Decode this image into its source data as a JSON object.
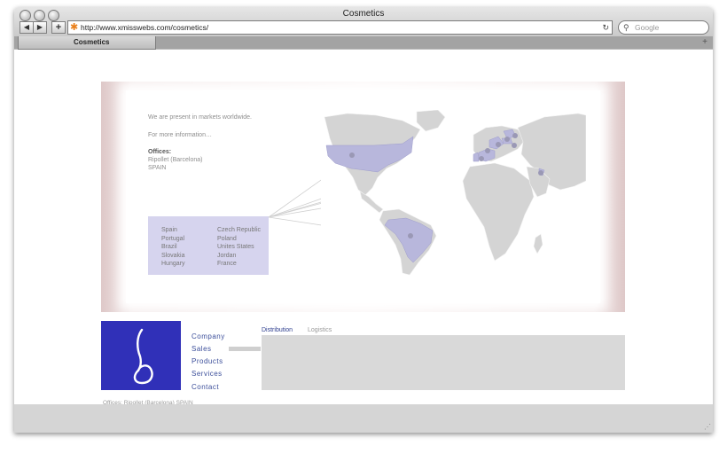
{
  "window": {
    "title": "Cosmetics",
    "url": "http://www.xmisswebs.com/cosmetics/",
    "search_placeholder": "Google",
    "tab_label": "Cosmetics",
    "back_glyph": "◀",
    "forward_glyph": "▶",
    "add_glyph": "+",
    "reload_glyph": "↻",
    "search_glyph": "⚲",
    "new_tab_glyph": "+"
  },
  "hero": {
    "line1": "We are present in markets worldwide.",
    "line2": "For more information…",
    "offices_heading": "Offices:",
    "office_city": "Ripollet (Barcelona)",
    "office_country": "SPAIN",
    "countries_left": [
      "Spain",
      "Portugal",
      "Brazil",
      "Slovakia",
      "Hungary"
    ],
    "countries_right": [
      "Czech Republic",
      "Poland",
      "Unites States",
      "Jordan",
      "France"
    ]
  },
  "nav": {
    "items": [
      "Company",
      "Sales",
      "Products",
      "Services",
      "Contact"
    ]
  },
  "subtabs": {
    "distribution": "Distribution",
    "logistics": "Logistics"
  },
  "footer": {
    "text": "Offices: Ripollet (Barcelona) SPAIN"
  },
  "colors": {
    "logo_bg": "#3030b8",
    "nav_text": "#3b4e9a",
    "highlight": "#b8b7dc",
    "country_box": "#d6d4ee"
  },
  "icons": {
    "logo": "stylized-b-logo",
    "map": "world-map-icon",
    "resize": "resize-grip-icon"
  }
}
